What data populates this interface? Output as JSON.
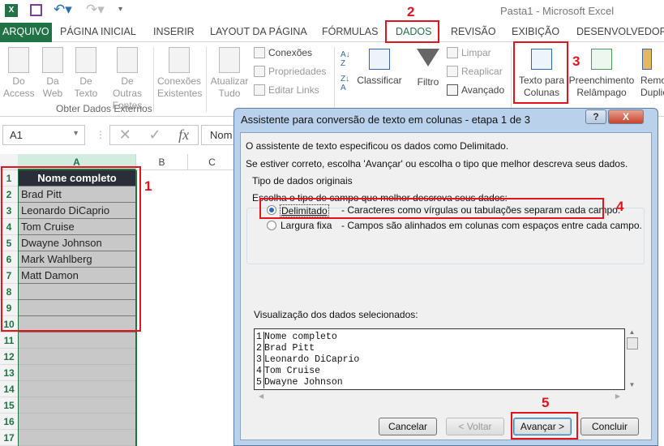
{
  "window": {
    "title": "Pasta1 - Microsoft Excel"
  },
  "qat": {
    "icons": [
      "excel-icon",
      "save-icon",
      "undo-icon",
      "redo-icon",
      "customize-icon"
    ]
  },
  "tabs": [
    {
      "label": "ARQUIVO"
    },
    {
      "label": "PÁGINA INICIAL"
    },
    {
      "label": "INSERIR"
    },
    {
      "label": "LAYOUT DA PÁGINA"
    },
    {
      "label": "FÓRMULAS"
    },
    {
      "label": "DADOS",
      "active": true
    },
    {
      "label": "REVISÃO"
    },
    {
      "label": "EXIBIÇÃO"
    },
    {
      "label": "DESENVOLVEDOR"
    }
  ],
  "ribbon": {
    "external": {
      "do_access": "Do",
      "do_access2": "Access",
      "da_web": "Da",
      "da_web2": "Web",
      "de_texto": "De",
      "de_texto2": "Texto",
      "outras": "De Outras",
      "outras2": "Fontes",
      "existentes": "Conexões",
      "existentes2": "Existentes",
      "group": "Obter Dados Externos"
    },
    "connections": {
      "atualizar": "Atualizar",
      "atualizar2": "Tudo",
      "conexoes": "Conexões",
      "propriedades": "Propriedades",
      "editar_links": "Editar Links"
    },
    "sort": {
      "classificar": "Classificar",
      "filtro": "Filtro",
      "limpar": "Limpar",
      "reaplicar": "Reaplicar",
      "avancado": "Avançado"
    },
    "tools": {
      "texto_colunas": "Texto para",
      "texto_colunas2": "Colunas",
      "preenchimento": "Preenchimento",
      "preenchimento2": "Relâmpago",
      "remover": "Remo",
      "remover2": "Duplic"
    }
  },
  "formula_bar": {
    "name_box": "A1",
    "content": "Nom"
  },
  "sheet": {
    "columns": [
      "A",
      "B",
      "C"
    ],
    "rows": [
      "1",
      "2",
      "3",
      "4",
      "5",
      "6",
      "7",
      "8",
      "9",
      "10",
      "11",
      "12",
      "13",
      "14",
      "15",
      "16",
      "17"
    ],
    "cells": [
      "Nome completo",
      "Brad Pitt",
      "Leonardo DiCaprio",
      "Tom Cruise",
      "Dwayne Johnson",
      "Mark Wahlberg",
      "Matt Damon"
    ]
  },
  "annotations": {
    "n1": "1",
    "n2": "2",
    "n3": "3",
    "n4": "4",
    "n5": "5",
    "color": "#e3141e"
  },
  "dialog": {
    "title": "Assistente para conversão de texto em colunas - etapa 1 de 3",
    "help": "?",
    "close": "X",
    "line1": "O assistente de texto especificou os dados como Delimitado.",
    "line2": "Se estiver correto, escolha 'Avançar' ou escolha o tipo que melhor descreva seus dados.",
    "group": "Tipo de dados originais",
    "prompt": "Escolha o tipo de campo que melhor descreva seus dados:",
    "options": [
      {
        "label": "Delimitado",
        "desc": "- Caracteres como vírgulas ou tabulações separam cada campo.",
        "selected": true
      },
      {
        "label": "Largura fixa",
        "desc": "- Campos são alinhados em colunas com espaços entre cada campo.",
        "selected": false
      }
    ],
    "preview_label": "Visualização dos dados selecionados:",
    "preview": [
      {
        "n": "1",
        "text": "Nome completo"
      },
      {
        "n": "2",
        "text": "Brad Pitt"
      },
      {
        "n": "3",
        "text": "Leonardo DiCaprio"
      },
      {
        "n": "4",
        "text": "Tom Cruise"
      },
      {
        "n": "5",
        "text": "Dwayne Johnson"
      }
    ],
    "buttons": {
      "cancel": "Cancelar",
      "back": "< Voltar",
      "next": "Avançar >",
      "finish": "Concluir"
    }
  }
}
